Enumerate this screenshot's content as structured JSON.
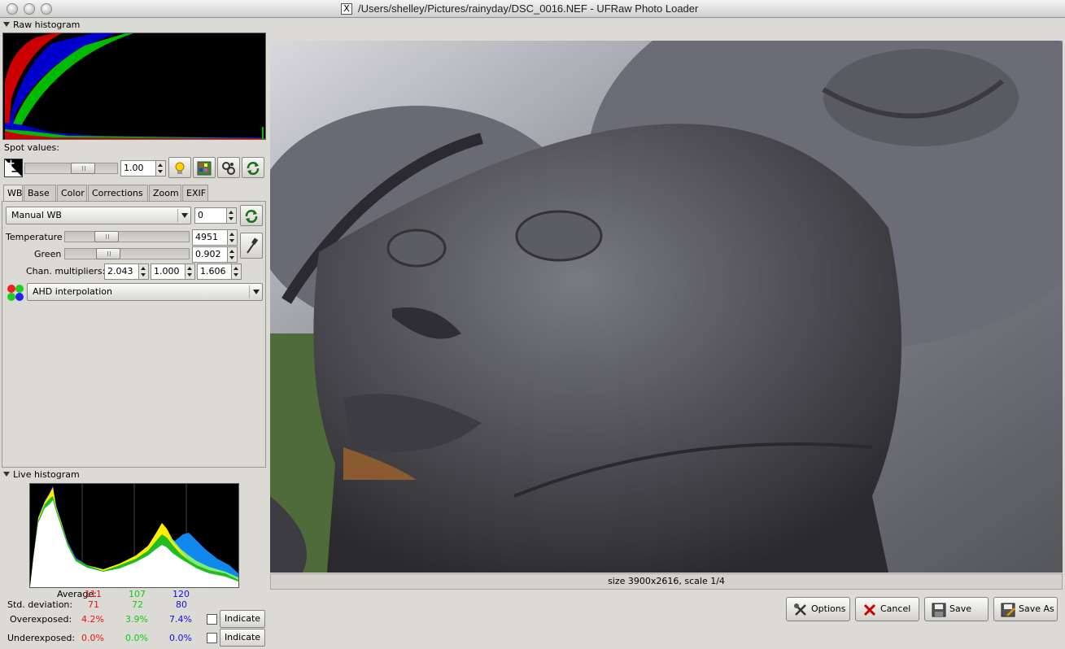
{
  "window": {
    "title": "/Users/shelley/Pictures/rainyday/DSC_0016.NEF - UFRaw Photo Loader",
    "x_badge": "X"
  },
  "raw_histogram": {
    "label": "Raw histogram"
  },
  "spot": {
    "label": "Spot values:"
  },
  "exposure": {
    "value": "1.00"
  },
  "tabs": [
    "WB",
    "Base",
    "Color",
    "Corrections",
    "Zoom",
    "EXIF"
  ],
  "wb": {
    "preset": "Manual WB",
    "fine_tune": "0",
    "temperature_label": "Temperature",
    "temperature": "4951",
    "green_label": "Green",
    "green": "0.902",
    "chan_label": "Chan. multipliers:",
    "chan": [
      "2.043",
      "1.000",
      "1.606"
    ],
    "interpolation": "AHD interpolation"
  },
  "live_histogram": {
    "label": "Live histogram",
    "average_label": "Average:",
    "average": [
      "111",
      "107",
      "120"
    ],
    "std_label": "Std. deviation:",
    "std": [
      "71",
      "72",
      "80"
    ],
    "over_label": "Overexposed:",
    "over": [
      "4.2%",
      "3.9%",
      "7.4%"
    ],
    "under_label": "Underexposed:",
    "under": [
      "0.0%",
      "0.0%",
      "0.0%"
    ],
    "indicate": "Indicate"
  },
  "status": {
    "text": "size 3900x2616, scale 1/4"
  },
  "buttons": {
    "options": "Options",
    "cancel": "Cancel",
    "save": "Save",
    "save_as": "Save As"
  },
  "colors": {
    "red": "#e11",
    "green": "#1c1",
    "blue": "#11d"
  }
}
